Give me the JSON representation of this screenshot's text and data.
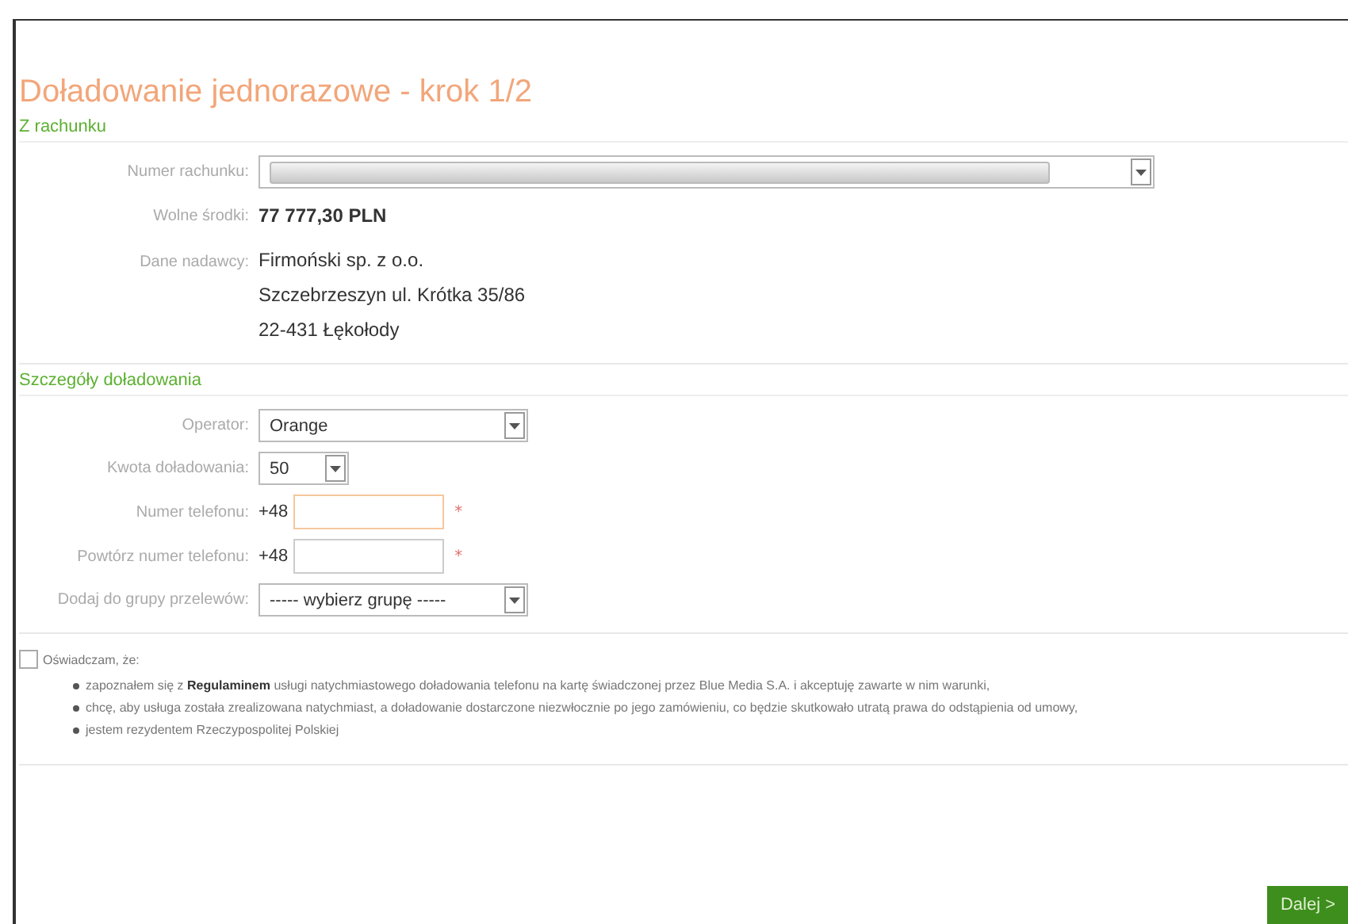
{
  "title": "Doładowanie jednorazowe - krok 1/2",
  "account_section": {
    "heading": "Z rachunku",
    "account_label": "Numer rachunku:",
    "funds_label": "Wolne środki:",
    "funds_value": "77 777,30 PLN",
    "sender_label": "Dane nadawcy:",
    "sender_lines": [
      "Firmoński sp. z o.o.",
      "Szczebrzeszyn ul. Krótka 35/86",
      "22-431 Łękołody"
    ]
  },
  "details_section": {
    "heading": "Szczegóły doładowania",
    "operator_label": "Operator:",
    "operator_value": "Orange",
    "amount_label": "Kwota doładowania:",
    "amount_value": "50",
    "phone_label": "Numer telefonu:",
    "phone_prefix": "+48",
    "phone_required": "*",
    "repeat_label": "Powtórz numer telefonu:",
    "repeat_prefix": "+48",
    "repeat_required": "*",
    "group_label": "Dodaj do grupy przelewów:",
    "group_value": "----- wybierz grupę -----"
  },
  "consent": {
    "checked": false,
    "label": "Oświadczam, że:",
    "items": [
      "zapoznałem się z **Regulaminem** usługi natychmiastowego doładowania telefonu na kartę świadczonej przez Blue Media S.A. i akceptuję zawarte w nim warunki,",
      "chcę, aby usługa została zrealizowana natychmiast, a doładowanie dostarczone niezwłocznie po jego zamówieniu, co będzie skutkowało utratą prawa do odstąpienia od umowy,",
      "jestem rezydentem Rzeczypospolitej Polskiej"
    ]
  },
  "next_button": "Dalej >"
}
